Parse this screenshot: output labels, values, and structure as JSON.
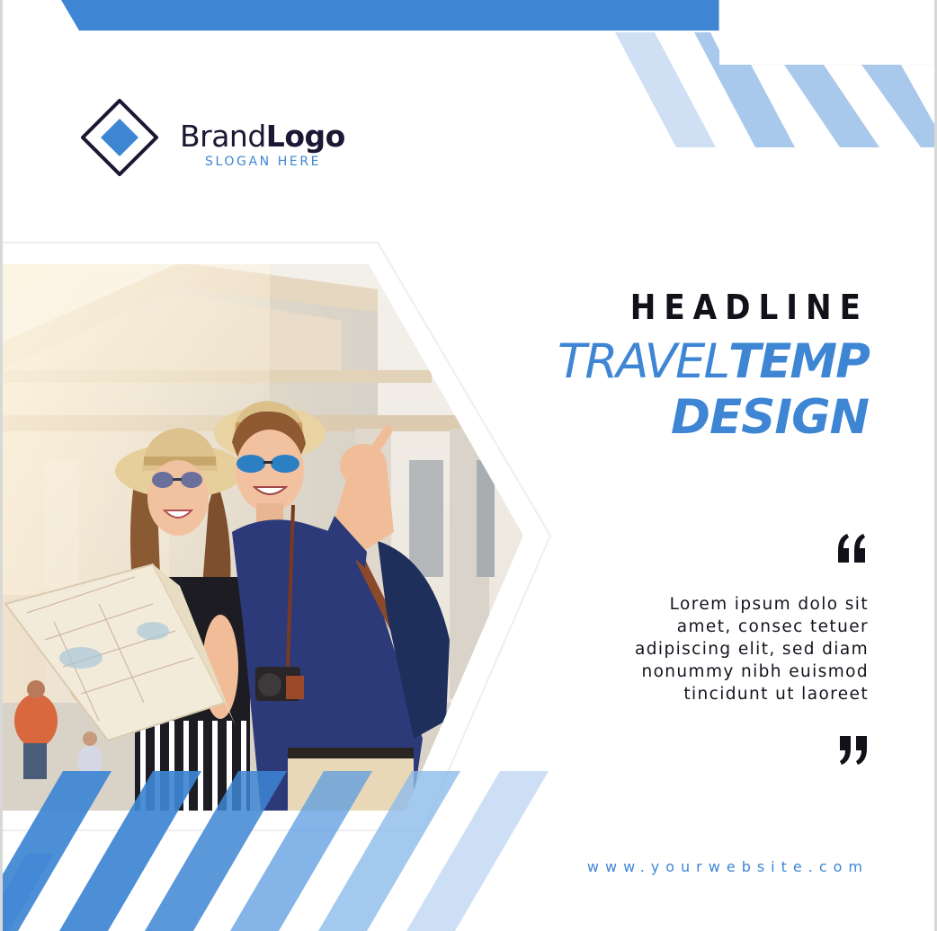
{
  "brand": {
    "name_light": "Brand",
    "name_bold": "Logo",
    "slogan": "SLOGAN HERE"
  },
  "headline": "HEADLINE",
  "title": {
    "line1_light": "TRAVEL",
    "line1_bold": "TEMP",
    "line2": "DESIGN"
  },
  "quote": {
    "open_icon": "quote-open-icon",
    "close_icon": "quote-close-icon",
    "text": "Lorem ipsum dolo sit\namet, consec tetuer\nadipiscing elit, sed diam\nnonummy nibh euismod\ntincidunt ut laoreet"
  },
  "website": "www.yourwebsite.com",
  "colors": {
    "accent": "#3e86d4",
    "accent_light": "#a9c9ec",
    "accent_pale": "#cfe0f4",
    "dark": "#121018",
    "background": "#ffffff"
  }
}
